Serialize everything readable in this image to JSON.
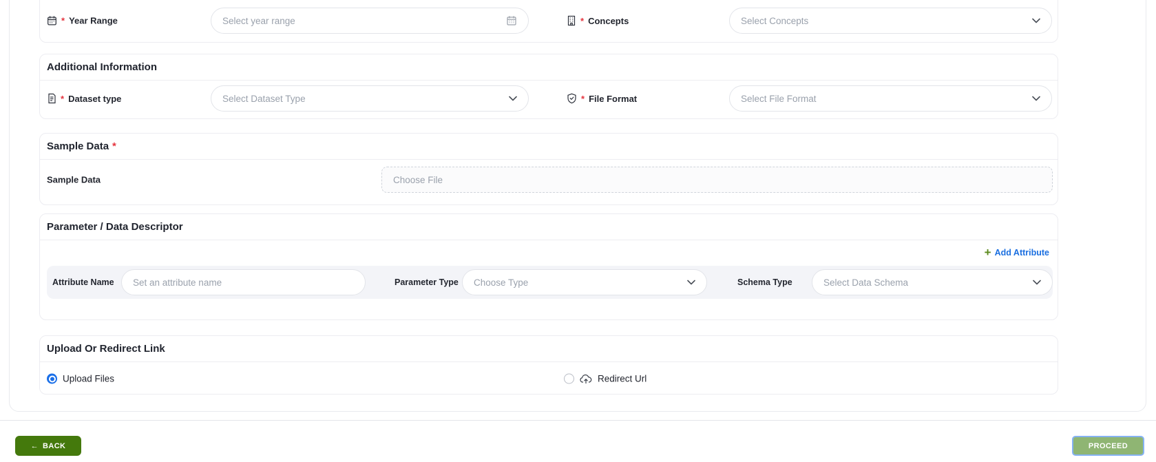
{
  "icons": {
    "back_arrow": "←",
    "add_plus": "+",
    "required_mark": "*"
  },
  "top_section": {
    "year_range": {
      "label": "Year Range",
      "placeholder": "Select year range"
    },
    "concepts": {
      "label": "Concepts",
      "placeholder": "Select Concepts"
    }
  },
  "additional_information": {
    "title": "Additional Information",
    "dataset_type": {
      "label": "Dataset type",
      "placeholder": "Select Dataset Type"
    },
    "file_format": {
      "label": "File Format",
      "placeholder": "Select File Format"
    }
  },
  "sample_data": {
    "title": "Sample Data",
    "label": "Sample Data",
    "file_placeholder": "Choose File"
  },
  "parameter_descriptor": {
    "title": "Parameter / Data Descriptor",
    "add_attribute": "Add Attribute",
    "attribute_name": {
      "label": "Attribute Name",
      "placeholder": "Set an attribute name"
    },
    "parameter_type": {
      "label": "Parameter Type",
      "placeholder": "Choose Type"
    },
    "schema_type": {
      "label": "Schema Type",
      "placeholder": "Select Data Schema"
    }
  },
  "upload_or_redirect": {
    "title": "Upload Or Redirect Link",
    "upload_files": "Upload Files",
    "redirect_url": "Redirect Url",
    "selected": "Upload Files"
  },
  "footer": {
    "back": "BACK",
    "proceed": "PROCEED"
  },
  "colors": {
    "back_button": "#44790c",
    "proceed_button": "#8fb573",
    "proceed_focus_ring": "#85b2f3",
    "link_blue": "#1b6fe0",
    "plus_green": "#5c8a1e",
    "radio_selected_blue": "#1a6fe8",
    "asterisk_red": "#e5353f"
  }
}
